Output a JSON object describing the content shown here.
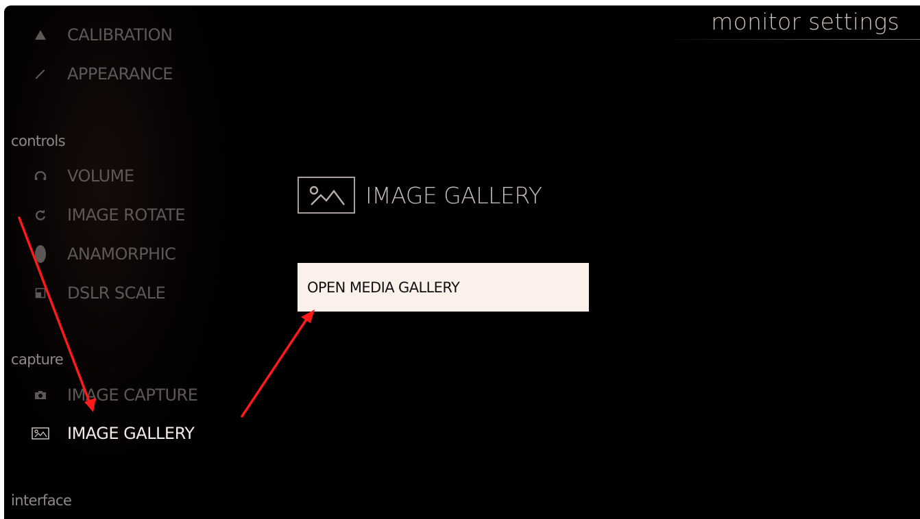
{
  "header": {
    "title": "monitor settings"
  },
  "sidebar": {
    "top_items": [
      {
        "label": "CALIBRATION",
        "icon": "triangle-icon"
      },
      {
        "label": "APPEARANCE",
        "icon": "pen-icon"
      }
    ],
    "sections": [
      {
        "title": "controls",
        "items": [
          {
            "label": "VOLUME",
            "icon": "headphones-icon"
          },
          {
            "label": "IMAGE ROTATE",
            "icon": "rotate-icon"
          },
          {
            "label": "ANAMORPHIC",
            "icon": "anamorphic-icon"
          },
          {
            "label": "DSLR SCALE",
            "icon": "scale-icon"
          }
        ]
      },
      {
        "title": "capture",
        "items": [
          {
            "label": "IMAGE CAPTURE",
            "icon": "camera-icon"
          },
          {
            "label": "IMAGE GALLERY",
            "icon": "image-icon",
            "selected": true
          }
        ]
      },
      {
        "title": "interface",
        "items": []
      }
    ]
  },
  "panel": {
    "title": "IMAGE GALLERY",
    "icon": "image-icon",
    "button_label": "OPEN MEDIA GALLERY"
  },
  "annotations": {
    "arrow_color": "#ff1a1a"
  },
  "colors": {
    "background": "#000000",
    "selected_text": "#f2ebe7",
    "inactive_text": "#5d5856",
    "button_background": "#fcf0ea"
  }
}
